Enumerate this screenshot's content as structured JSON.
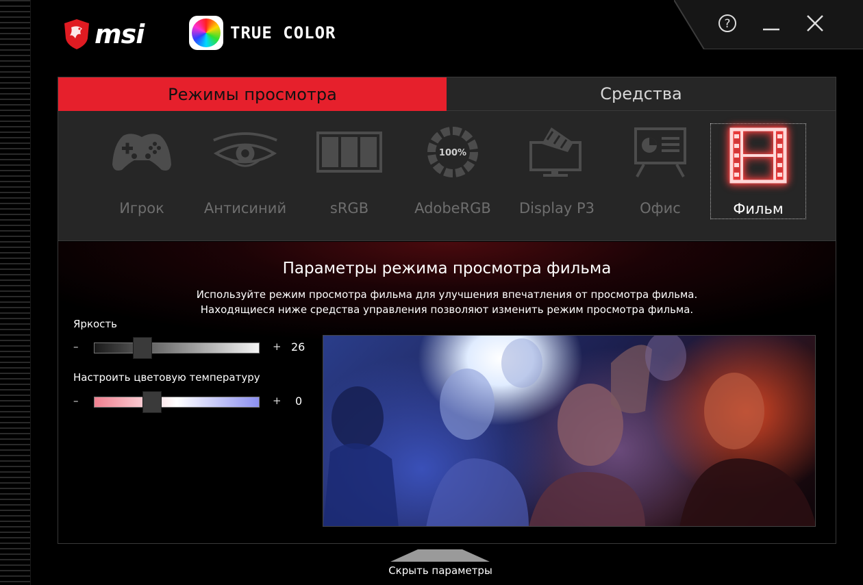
{
  "header": {
    "brand": "msi",
    "product": "TRUE COLOR",
    "help_symbol": "?"
  },
  "tabs": [
    {
      "label": "Режимы просмотра",
      "active": true
    },
    {
      "label": "Средства",
      "active": false
    }
  ],
  "modes": [
    {
      "label": "Игрок",
      "icon": "gamepad-icon"
    },
    {
      "label": "Антисиний",
      "icon": "eye-icon"
    },
    {
      "label": "sRGB",
      "icon": "panels-icon"
    },
    {
      "label": "AdobeRGB",
      "icon": "gauge-100-icon",
      "badge": "100%"
    },
    {
      "label": "Display P3",
      "icon": "monitor-clapper-icon"
    },
    {
      "label": "Офис",
      "icon": "presentation-icon"
    },
    {
      "label": "Фильм",
      "icon": "film-icon",
      "selected": true
    }
  ],
  "settings": {
    "title": "Параметры режима просмотра фильма",
    "desc_line1": "Используйте режим просмотра фильма для улучшения впечатления от просмотра фильма.",
    "desc_line2": "Находящиеся ниже средства управления позволяют изменить режим просмотра фильма.",
    "brightness": {
      "label": "Яркость",
      "minus": "–",
      "plus": "+",
      "value": "26",
      "fraction": 0.29
    },
    "temperature": {
      "label": "Настроить цветовую температуру",
      "minus": "–",
      "plus": "+",
      "value": "0",
      "fraction": 0.35
    }
  },
  "footer": {
    "hide_label": "Скрыть параметры"
  },
  "colors": {
    "accent": "#e6202c",
    "panel": "#262626",
    "inactive_text": "#6e6e6e"
  }
}
